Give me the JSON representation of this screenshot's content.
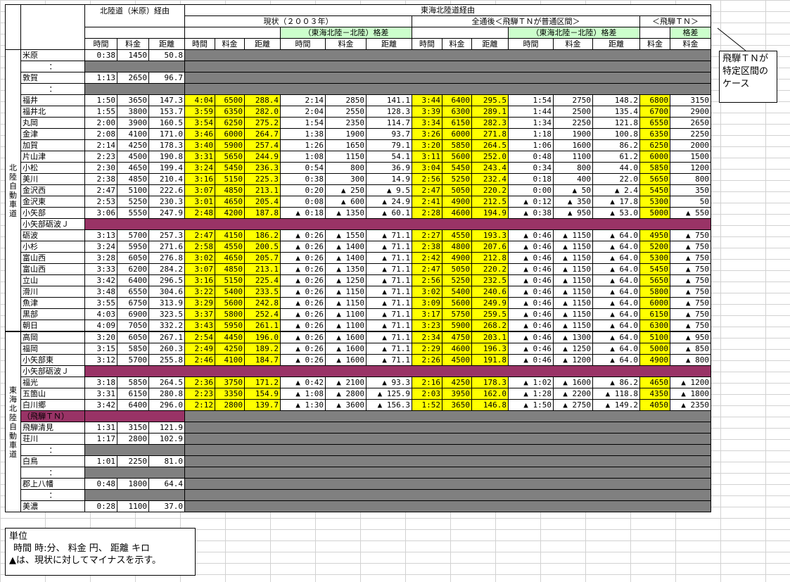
{
  "headers": {
    "hokuriku_route": "北陸道（米原）経由",
    "tokai_route": "東海北陸道経由",
    "current": "現状（２００３年）",
    "full": "全通後＜飛騨ＴＮが普通区間＞",
    "hida_tn": "＜飛騨ＴＮ＞",
    "diff": "（東海北陸－北陸）格差",
    "diff_short": "格差",
    "time": "時間",
    "fare": "料金",
    "dist": "距離"
  },
  "section_labels": {
    "hokuriku": "北陸自動車道",
    "tokai": "東海北陸自動車道"
  },
  "rows": [
    {
      "t": "d",
      "n": "米原",
      "h": [
        "0:38",
        "1450",
        "50.8"
      ],
      "g": true
    },
    {
      "t": "d",
      "n": "：",
      "h": [
        "",
        "",
        ""
      ],
      "g": true,
      "hg": true
    },
    {
      "t": "d",
      "n": "敦賀",
      "h": [
        "1:13",
        "2650",
        "96.7"
      ],
      "g": true
    },
    {
      "t": "d",
      "n": "：",
      "h": [
        "",
        "",
        ""
      ],
      "g": true,
      "hg": true
    },
    {
      "t": "d",
      "n": "福井",
      "h": [
        "1:50",
        "3650",
        "147.3"
      ],
      "c": [
        "4:04",
        "6500",
        "288.4"
      ],
      "cd": [
        "2:14",
        "2850",
        "141.1"
      ],
      "f": [
        "3:44",
        "6400",
        "295.5"
      ],
      "fd": [
        "1:54",
        "2750",
        "148.2"
      ],
      "k": "6800",
      "kd": "3150"
    },
    {
      "t": "d",
      "n": "福井北",
      "h": [
        "1:55",
        "3800",
        "153.7"
      ],
      "c": [
        "3:59",
        "6350",
        "282.0"
      ],
      "cd": [
        "2:04",
        "2550",
        "128.3"
      ],
      "f": [
        "3:39",
        "6300",
        "289.1"
      ],
      "fd": [
        "1:44",
        "2500",
        "135.4"
      ],
      "k": "6700",
      "kd": "2900"
    },
    {
      "t": "d",
      "n": "丸岡",
      "h": [
        "2:00",
        "3900",
        "160.5"
      ],
      "c": [
        "3:54",
        "6250",
        "275.2"
      ],
      "cd": [
        "1:54",
        "2350",
        "114.7"
      ],
      "f": [
        "3:34",
        "6150",
        "282.3"
      ],
      "fd": [
        "1:34",
        "2250",
        "121.8"
      ],
      "k": "6550",
      "kd": "2650"
    },
    {
      "t": "d",
      "n": "金津",
      "h": [
        "2:08",
        "4100",
        "171.0"
      ],
      "c": [
        "3:46",
        "6000",
        "264.7"
      ],
      "cd": [
        "1:38",
        "1900",
        "93.7"
      ],
      "f": [
        "3:26",
        "6000",
        "271.8"
      ],
      "fd": [
        "1:18",
        "1900",
        "100.8"
      ],
      "k": "6350",
      "kd": "2250"
    },
    {
      "t": "d",
      "n": "加賀",
      "h": [
        "2:14",
        "4250",
        "178.3"
      ],
      "c": [
        "3:40",
        "5900",
        "257.4"
      ],
      "cd": [
        "1:26",
        "1650",
        "79.1"
      ],
      "f": [
        "3:20",
        "5850",
        "264.5"
      ],
      "fd": [
        "1:06",
        "1600",
        "86.2"
      ],
      "k": "6250",
      "kd": "2000"
    },
    {
      "t": "d",
      "n": "片山津",
      "h": [
        "2:23",
        "4500",
        "190.8"
      ],
      "c": [
        "3:31",
        "5650",
        "244.9"
      ],
      "cd": [
        "1:08",
        "1150",
        "54.1"
      ],
      "f": [
        "3:11",
        "5600",
        "252.0"
      ],
      "fd": [
        "0:48",
        "1100",
        "61.2"
      ],
      "k": "6000",
      "kd": "1500"
    },
    {
      "t": "d",
      "n": "小松",
      "h": [
        "2:30",
        "4650",
        "199.4"
      ],
      "c": [
        "3:24",
        "5450",
        "236.3"
      ],
      "cd": [
        "0:54",
        "800",
        "36.9"
      ],
      "f": [
        "3:04",
        "5450",
        "243.4"
      ],
      "fd": [
        "0:34",
        "800",
        "44.0"
      ],
      "k": "5850",
      "kd": "1200"
    },
    {
      "t": "d",
      "n": "美川",
      "h": [
        "2:38",
        "4850",
        "210.4"
      ],
      "c": [
        "3:16",
        "5150",
        "225.3"
      ],
      "cd": [
        "0:38",
        "300",
        "14.9"
      ],
      "f": [
        "2:56",
        "5250",
        "232.4"
      ],
      "fd": [
        "0:18",
        "400",
        "22.0"
      ],
      "k": "5650",
      "kd": "800"
    },
    {
      "t": "d",
      "n": "金沢西",
      "h": [
        "2:47",
        "5100",
        "222.6"
      ],
      "c": [
        "3:07",
        "4850",
        "213.1"
      ],
      "cd": [
        "0:20",
        "▲ 250",
        "▲ 9.5"
      ],
      "f": [
        "2:47",
        "5050",
        "220.2"
      ],
      "fd": [
        "0:00",
        "▲ 50",
        "▲ 2.4"
      ],
      "k": "5450",
      "kd": "350"
    },
    {
      "t": "d",
      "n": "金沢東",
      "h": [
        "2:53",
        "5250",
        "230.3"
      ],
      "c": [
        "3:01",
        "4650",
        "205.4"
      ],
      "cd": [
        "0:08",
        "▲ 600",
        "▲ 24.9"
      ],
      "f": [
        "2:41",
        "4900",
        "212.5"
      ],
      "fd": [
        "▲ 0:12",
        "▲ 350",
        "▲ 17.8"
      ],
      "k": "5300",
      "kd": "50"
    },
    {
      "t": "d",
      "n": "小矢部",
      "h": [
        "3:06",
        "5550",
        "247.9"
      ],
      "c": [
        "2:48",
        "4200",
        "187.8"
      ],
      "cd": [
        "▲ 0:18",
        "▲ 1350",
        "▲ 60.1"
      ],
      "f": [
        "2:28",
        "4600",
        "194.9"
      ],
      "fd": [
        "▲ 0:38",
        "▲ 950",
        "▲ 53.0"
      ],
      "k": "5000",
      "kd": "▲ 550"
    },
    {
      "t": "p",
      "n": "小矢部砺波Ｊ"
    },
    {
      "t": "d",
      "n": "砺波",
      "h": [
        "3:13",
        "5700",
        "257.3"
      ],
      "c": [
        "2:47",
        "4150",
        "186.2"
      ],
      "cd": [
        "▲ 0:26",
        "▲ 1550",
        "▲ 71.1"
      ],
      "f": [
        "2:27",
        "4550",
        "193.3"
      ],
      "fd": [
        "▲ 0:46",
        "▲ 1150",
        "▲ 64.0"
      ],
      "k": "4950",
      "kd": "▲ 750"
    },
    {
      "t": "d",
      "n": "小杉",
      "h": [
        "3:24",
        "5950",
        "271.6"
      ],
      "c": [
        "2:58",
        "4550",
        "200.5"
      ],
      "cd": [
        "▲ 0:26",
        "▲ 1400",
        "▲ 71.1"
      ],
      "f": [
        "2:38",
        "4800",
        "207.6"
      ],
      "fd": [
        "▲ 0:46",
        "▲ 1150",
        "▲ 64.0"
      ],
      "k": "5200",
      "kd": "▲ 750"
    },
    {
      "t": "d",
      "n": "富山西",
      "h": [
        "3:28",
        "6050",
        "276.8"
      ],
      "c": [
        "3:02",
        "4650",
        "205.7"
      ],
      "cd": [
        "▲ 0:26",
        "▲ 1400",
        "▲ 71.1"
      ],
      "f": [
        "2:42",
        "4900",
        "212.8"
      ],
      "fd": [
        "▲ 0:46",
        "▲ 1150",
        "▲ 64.0"
      ],
      "k": "5300",
      "kd": "▲ 750"
    },
    {
      "t": "d",
      "n": "富山西",
      "h": [
        "3:33",
        "6200",
        "284.2"
      ],
      "c": [
        "3:07",
        "4850",
        "213.1"
      ],
      "cd": [
        "▲ 0:26",
        "▲ 1350",
        "▲ 71.1"
      ],
      "f": [
        "2:47",
        "5050",
        "220.2"
      ],
      "fd": [
        "▲ 0:46",
        "▲ 1150",
        "▲ 64.0"
      ],
      "k": "5450",
      "kd": "▲ 750"
    },
    {
      "t": "d",
      "n": "立山",
      "h": [
        "3:42",
        "6400",
        "296.5"
      ],
      "c": [
        "3:16",
        "5150",
        "225.4"
      ],
      "cd": [
        "▲ 0:26",
        "▲ 1250",
        "▲ 71.1"
      ],
      "f": [
        "2:56",
        "5250",
        "232.5"
      ],
      "fd": [
        "▲ 0:46",
        "▲ 1150",
        "▲ 64.0"
      ],
      "k": "5650",
      "kd": "▲ 750"
    },
    {
      "t": "d",
      "n": "滑川",
      "h": [
        "3:48",
        "6550",
        "304.6"
      ],
      "c": [
        "3:22",
        "5400",
        "233.5"
      ],
      "cd": [
        "▲ 0:26",
        "▲ 1150",
        "▲ 71.1"
      ],
      "f": [
        "3:02",
        "5400",
        "240.6"
      ],
      "fd": [
        "▲ 0:46",
        "▲ 1150",
        "▲ 64.0"
      ],
      "k": "5800",
      "kd": "▲ 750"
    },
    {
      "t": "d",
      "n": "魚津",
      "h": [
        "3:55",
        "6750",
        "313.9"
      ],
      "c": [
        "3:29",
        "5600",
        "242.8"
      ],
      "cd": [
        "▲ 0:26",
        "▲ 1150",
        "▲ 71.1"
      ],
      "f": [
        "3:09",
        "5600",
        "249.9"
      ],
      "fd": [
        "▲ 0:46",
        "▲ 1150",
        "▲ 64.0"
      ],
      "k": "6000",
      "kd": "▲ 750"
    },
    {
      "t": "d",
      "n": "黒部",
      "h": [
        "4:03",
        "6900",
        "323.5"
      ],
      "c": [
        "3:37",
        "5800",
        "252.4"
      ],
      "cd": [
        "▲ 0:26",
        "▲ 1100",
        "▲ 71.1"
      ],
      "f": [
        "3:17",
        "5750",
        "259.5"
      ],
      "fd": [
        "▲ 0:46",
        "▲ 1150",
        "▲ 64.0"
      ],
      "k": "6150",
      "kd": "▲ 750"
    },
    {
      "t": "d",
      "n": "朝日",
      "h": [
        "4:09",
        "7050",
        "332.2"
      ],
      "c": [
        "3:43",
        "5950",
        "261.1"
      ],
      "cd": [
        "▲ 0:26",
        "▲ 1100",
        "▲ 71.1"
      ],
      "f": [
        "3:23",
        "5900",
        "268.2"
      ],
      "fd": [
        "▲ 0:46",
        "▲ 1150",
        "▲ 64.0"
      ],
      "k": "6300",
      "kd": "▲ 750"
    },
    {
      "t": "d",
      "n": "高岡",
      "h": [
        "3:20",
        "6050",
        "267.1"
      ],
      "c": [
        "2:54",
        "4450",
        "196.0"
      ],
      "cd": [
        "▲ 0:26",
        "▲ 1600",
        "▲ 71.1"
      ],
      "f": [
        "2:34",
        "4750",
        "203.1"
      ],
      "fd": [
        "▲ 0:46",
        "▲ 1300",
        "▲ 64.0"
      ],
      "k": "5100",
      "kd": "▲ 950"
    },
    {
      "t": "d",
      "n": "福岡",
      "h": [
        "3:15",
        "5850",
        "260.3"
      ],
      "c": [
        "2:49",
        "4250",
        "189.2"
      ],
      "cd": [
        "▲ 0:26",
        "▲ 1600",
        "▲ 71.1"
      ],
      "f": [
        "2:29",
        "4600",
        "196.3"
      ],
      "fd": [
        "▲ 0:46",
        "▲ 1250",
        "▲ 64.0"
      ],
      "k": "5000",
      "kd": "▲ 850"
    },
    {
      "t": "d",
      "n": "小矢部東",
      "h": [
        "3:12",
        "5700",
        "255.8"
      ],
      "c": [
        "2:46",
        "4100",
        "184.7"
      ],
      "cd": [
        "▲ 0:26",
        "▲ 1600",
        "▲ 71.1"
      ],
      "f": [
        "2:26",
        "4500",
        "191.8"
      ],
      "fd": [
        "▲ 0:46",
        "▲ 1200",
        "▲ 64.0"
      ],
      "k": "4900",
      "kd": "▲ 800"
    },
    {
      "t": "p",
      "n": "小矢部砺波Ｊ"
    },
    {
      "t": "d",
      "n": "福光",
      "h": [
        "3:18",
        "5850",
        "264.5"
      ],
      "c": [
        "2:36",
        "3750",
        "171.2"
      ],
      "cd": [
        "▲ 0:42",
        "▲ 2100",
        "▲ 93.3"
      ],
      "f": [
        "2:16",
        "4250",
        "178.3"
      ],
      "fd": [
        "▲ 1:02",
        "▲ 1600",
        "▲ 86.2"
      ],
      "k": "4650",
      "kd": "▲ 1200"
    },
    {
      "t": "d",
      "n": "五箇山",
      "h": [
        "3:31",
        "6150",
        "280.8"
      ],
      "c": [
        "2:23",
        "3350",
        "154.9"
      ],
      "cd": [
        "▲ 1:08",
        "▲ 2800",
        "▲ 125.9"
      ],
      "f": [
        "2:03",
        "3950",
        "162.0"
      ],
      "fd": [
        "▲ 1:28",
        "▲ 2200",
        "▲ 118.8"
      ],
      "k": "4350",
      "kd": "▲ 1800"
    },
    {
      "t": "d",
      "n": "白川郷",
      "h": [
        "3:42",
        "6400",
        "296.0"
      ],
      "c": [
        "2:12",
        "2800",
        "139.7"
      ],
      "cd": [
        "▲ 1:30",
        "▲ 3600",
        "▲ 156.3"
      ],
      "f": [
        "1:52",
        "3650",
        "146.8"
      ],
      "fd": [
        "▲ 1:50",
        "▲ 2750",
        "▲ 149.2"
      ],
      "k": "4050",
      "kd": "▲ 2350"
    },
    {
      "t": "pp",
      "n": "（飛騨ＴＮ）"
    },
    {
      "t": "d",
      "n": "飛騨清見",
      "h": [
        "1:31",
        "3150",
        "121.9"
      ],
      "g": true
    },
    {
      "t": "d",
      "n": "荘川",
      "h": [
        "1:17",
        "2800",
        "102.9"
      ],
      "g": true
    },
    {
      "t": "d",
      "n": "：",
      "h": [
        "",
        "",
        ""
      ],
      "g": true,
      "hg": true
    },
    {
      "t": "d",
      "n": "白鳥",
      "h": [
        "1:01",
        "2250",
        "81.0"
      ],
      "g": true
    },
    {
      "t": "d",
      "n": "：",
      "h": [
        "",
        "",
        ""
      ],
      "g": true,
      "hg": true
    },
    {
      "t": "d",
      "n": "郡上八幡",
      "h": [
        "0:48",
        "1800",
        "64.4"
      ],
      "g": true
    },
    {
      "t": "d",
      "n": "：",
      "h": [
        "",
        "",
        ""
      ],
      "g": true,
      "hg": true
    },
    {
      "t": "d",
      "n": "美濃",
      "h": [
        "0:28",
        "1100",
        "37.0"
      ],
      "g": true
    }
  ],
  "callout": [
    "飛騨ＴＮが",
    "特定区間の",
    "ケース"
  ],
  "units": {
    "title": "単位",
    "line1": "時間 時:分、 料金 円、 距離 キロ",
    "line2": "▲は、現状に対してマイナスを示す。"
  }
}
